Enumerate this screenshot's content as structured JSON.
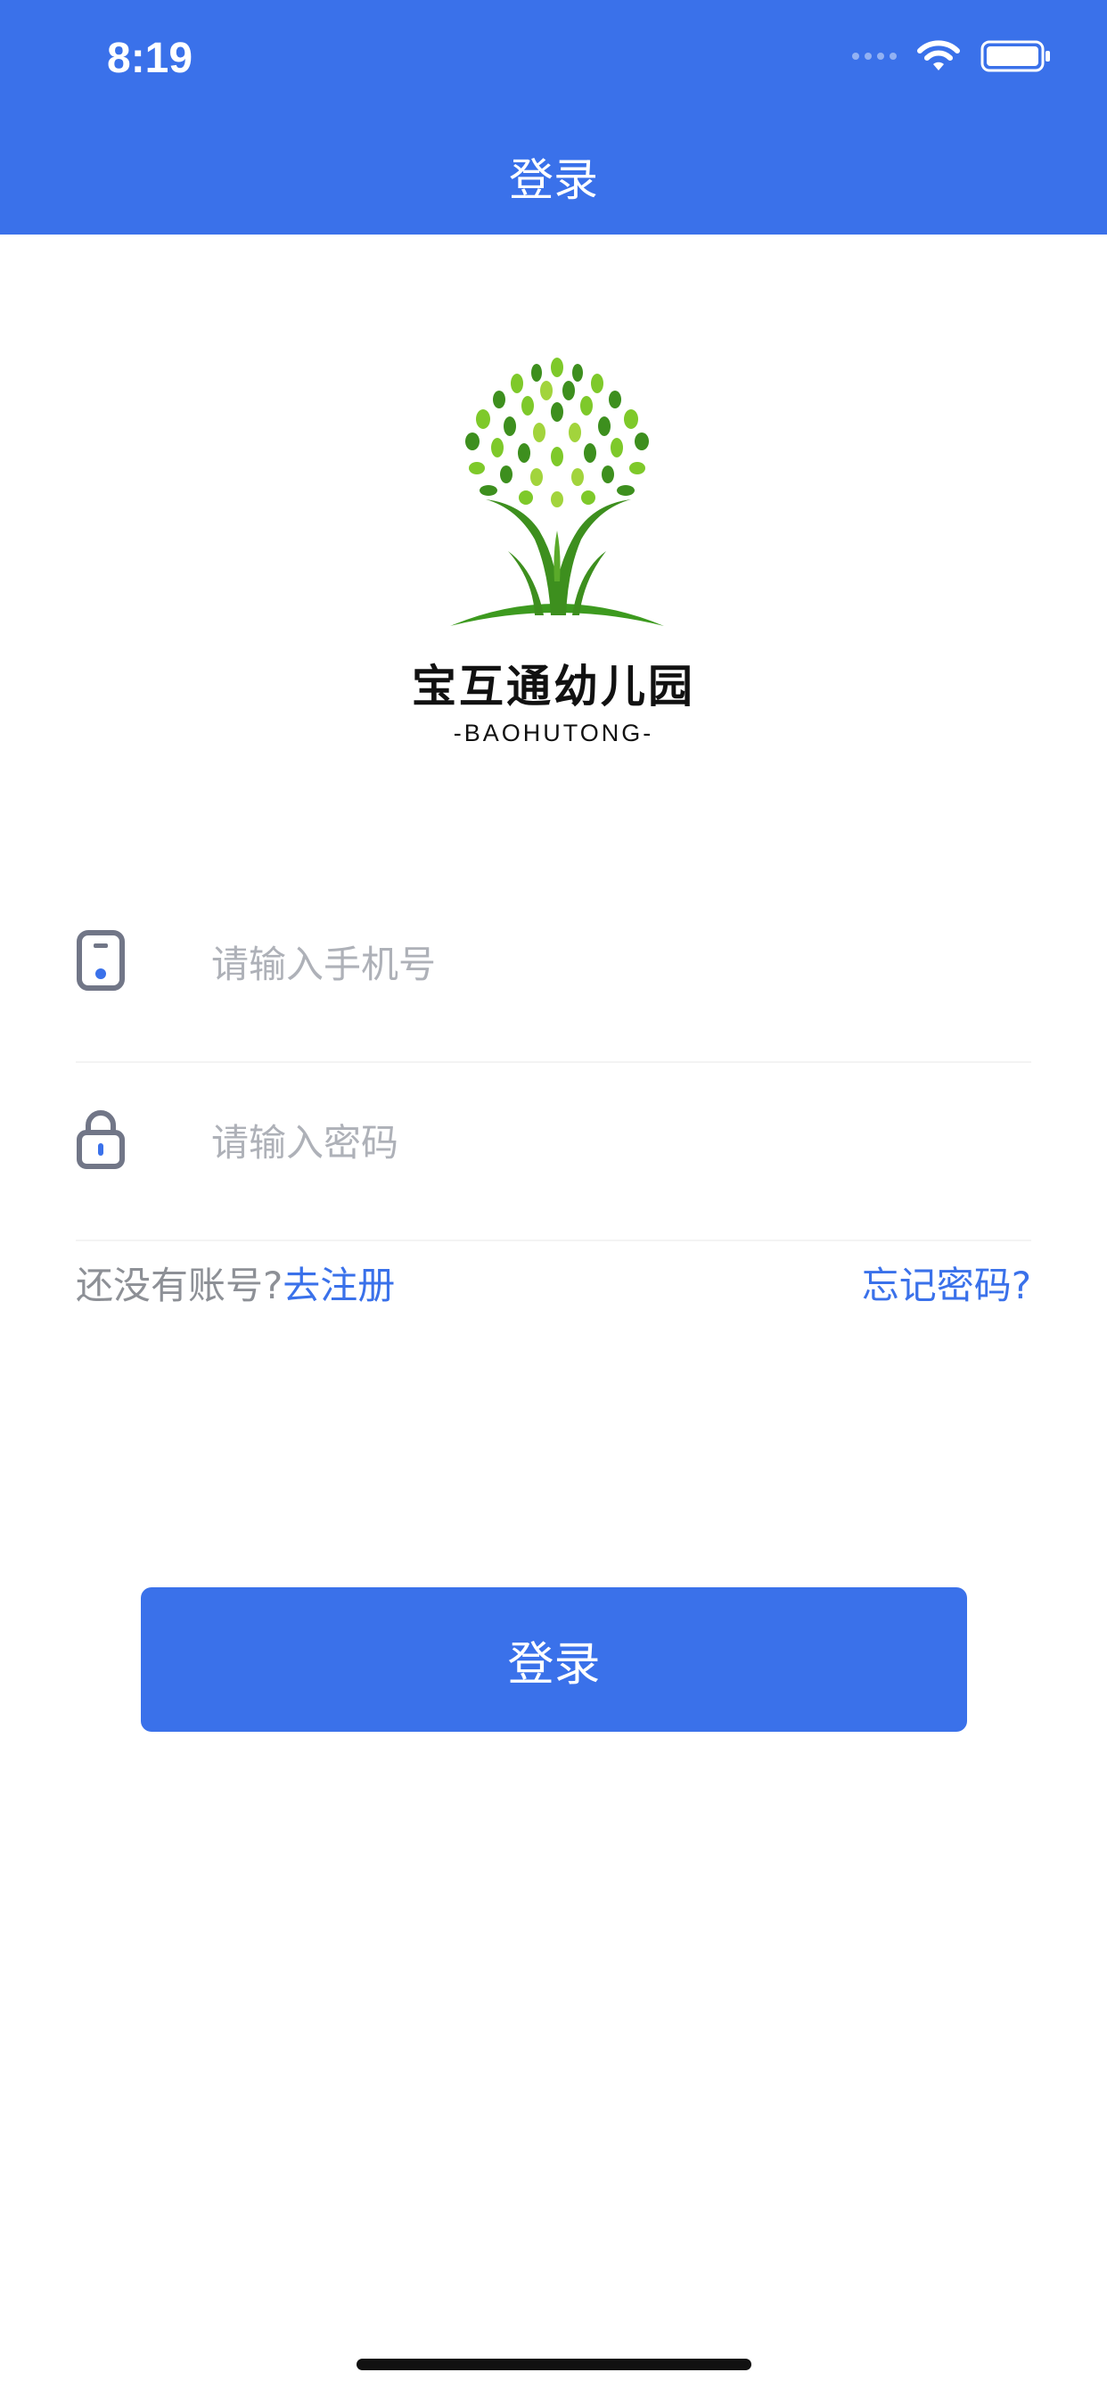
{
  "status_bar": {
    "time": "8:19"
  },
  "nav": {
    "title": "登录"
  },
  "brand": {
    "name": "宝互通幼儿园",
    "subtitle": "-BAOHUTONG-"
  },
  "form": {
    "phone_placeholder": "请输入手机号",
    "password_placeholder": "请输入密码"
  },
  "links": {
    "no_account": "还没有账号?",
    "register": "去注册",
    "forgot": "忘记密码?"
  },
  "login_button": "登录",
  "colors": {
    "primary": "#3a71ea",
    "hint": "#8d9096",
    "icon": "#717687"
  }
}
